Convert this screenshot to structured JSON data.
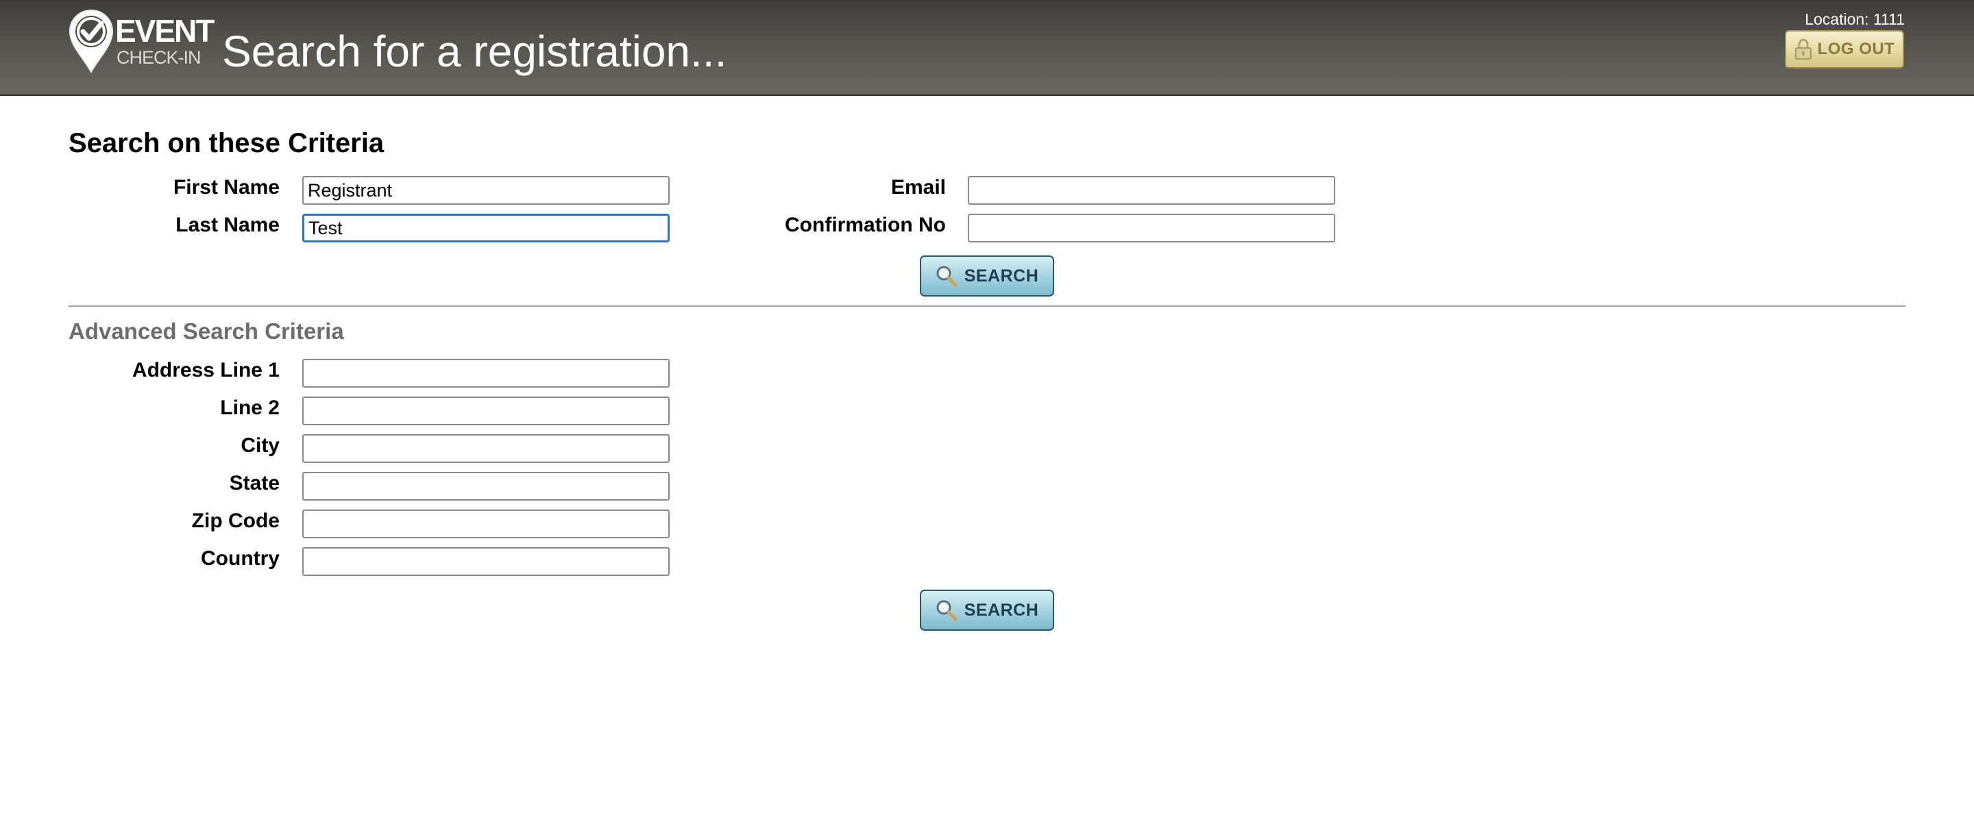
{
  "header": {
    "logo": {
      "line1": "EVENT",
      "line2": "CHECK-IN"
    },
    "title": "Search for a registration...",
    "location": "Location: 1111",
    "logout_label": "LOG OUT"
  },
  "criteria": {
    "title": "Search on these Criteria",
    "first_name": {
      "label": "First Name",
      "value": "Registrant"
    },
    "last_name": {
      "label": "Last Name",
      "value": "Test"
    },
    "email": {
      "label": "Email",
      "value": ""
    },
    "confirmation": {
      "label": "Confirmation No",
      "value": ""
    },
    "search_label": "SEARCH"
  },
  "advanced": {
    "title": "Advanced Search Criteria",
    "address1": {
      "label": "Address Line 1",
      "value": ""
    },
    "line2": {
      "label": "Line 2",
      "value": ""
    },
    "city": {
      "label": "City",
      "value": ""
    },
    "state": {
      "label": "State",
      "value": ""
    },
    "zip": {
      "label": "Zip Code",
      "value": ""
    },
    "country": {
      "label": "Country",
      "value": ""
    },
    "search_label": "SEARCH"
  },
  "colors": {
    "header_bg": "#55534e",
    "search_button": "#a8d4e1",
    "logout_button": "#e5d9a4",
    "focus_border": "#2f6fd0"
  },
  "icons": {
    "logo": "checkmark-pin-icon",
    "logout": "padlock-icon",
    "search": "magnifier-icon"
  }
}
